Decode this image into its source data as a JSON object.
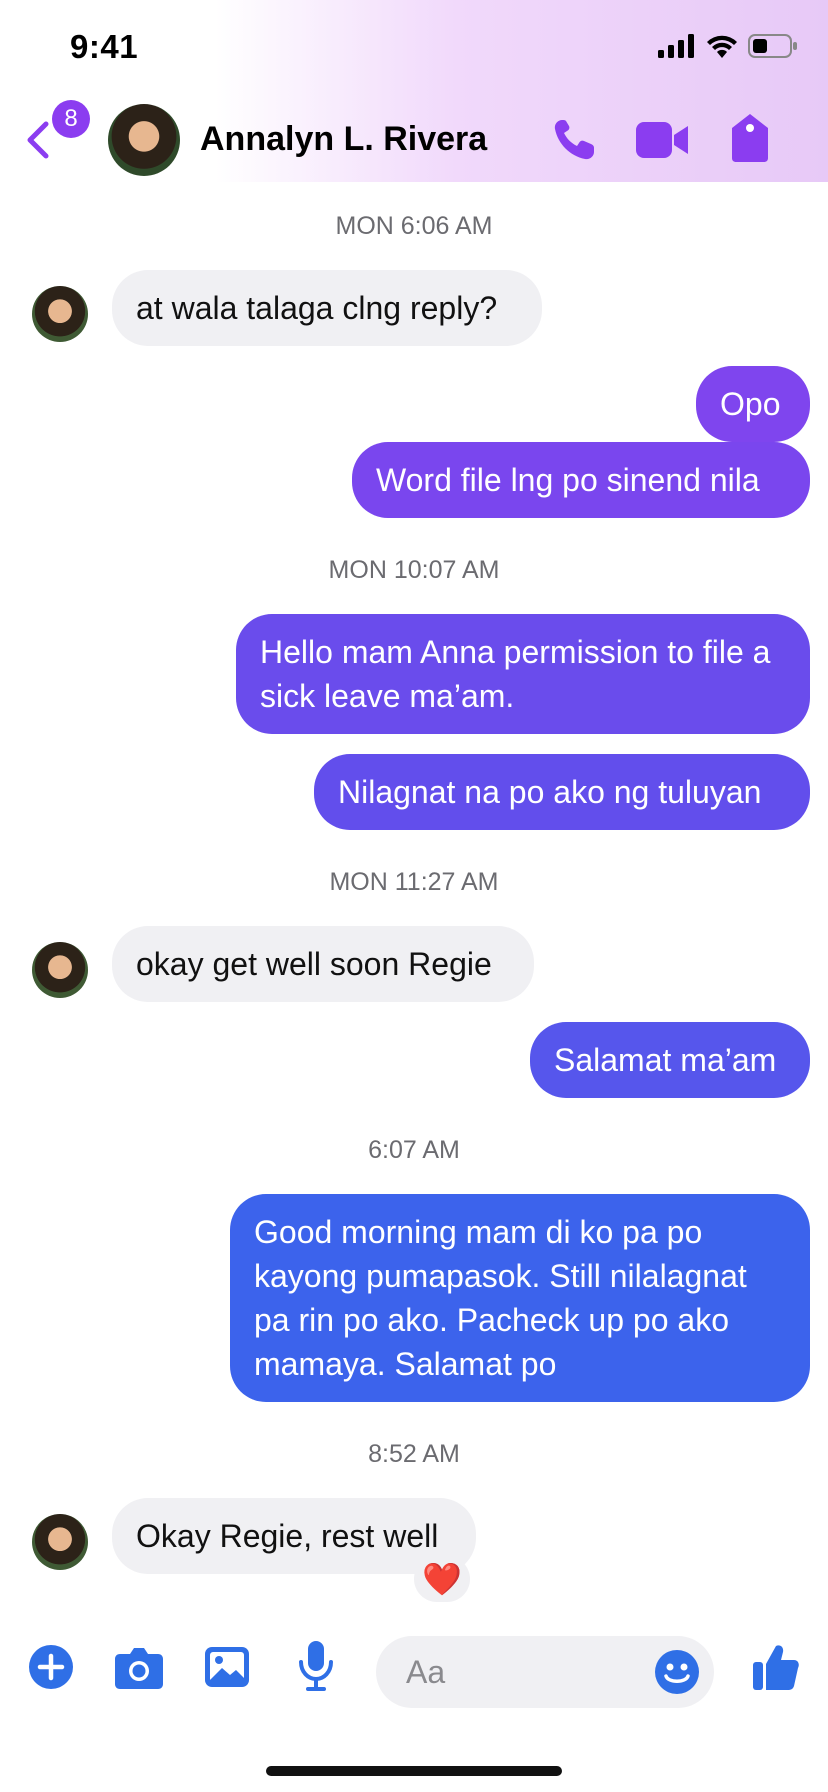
{
  "status_bar": {
    "time": "9:41"
  },
  "header": {
    "back_badge": "8",
    "contact_name": "Annalyn L. Rivera",
    "accent_color": "#8b3df0"
  },
  "messages": [
    {
      "type": "timestamp",
      "text": "MON 6:06 AM"
    },
    {
      "type": "incoming",
      "text": "at wala talaga clng reply?"
    },
    {
      "type": "outgoing",
      "text": "Opo"
    },
    {
      "type": "outgoing",
      "text": "Word file lng po sinend nila"
    },
    {
      "type": "timestamp",
      "text": "MON 10:07 AM"
    },
    {
      "type": "outgoing",
      "text": "Hello mam Anna permission to file a sick leave ma’am."
    },
    {
      "type": "outgoing",
      "text": "Nilagnat na po ako ng tuluyan"
    },
    {
      "type": "timestamp",
      "text": "MON 11:27 AM"
    },
    {
      "type": "incoming",
      "text": "okay get well soon Regie"
    },
    {
      "type": "outgoing",
      "text": "Salamat ma’am"
    },
    {
      "type": "timestamp",
      "text": "6:07 AM"
    },
    {
      "type": "outgoing",
      "text": "Good morning mam di ko pa po kayong pumapasok. Still nilalagnat pa rin po ako. Pacheck up po ako mamaya. Salamat po"
    },
    {
      "type": "timestamp",
      "text": "8:52 AM"
    },
    {
      "type": "incoming",
      "text": "Okay Regie, rest well",
      "reaction": "❤️"
    }
  ],
  "composer": {
    "placeholder": "Aa",
    "icons": [
      "plus-icon",
      "camera-icon",
      "gallery-icon",
      "microphone-icon",
      "emoji-icon",
      "like-icon"
    ],
    "icon_color": "#2f6fe6"
  }
}
